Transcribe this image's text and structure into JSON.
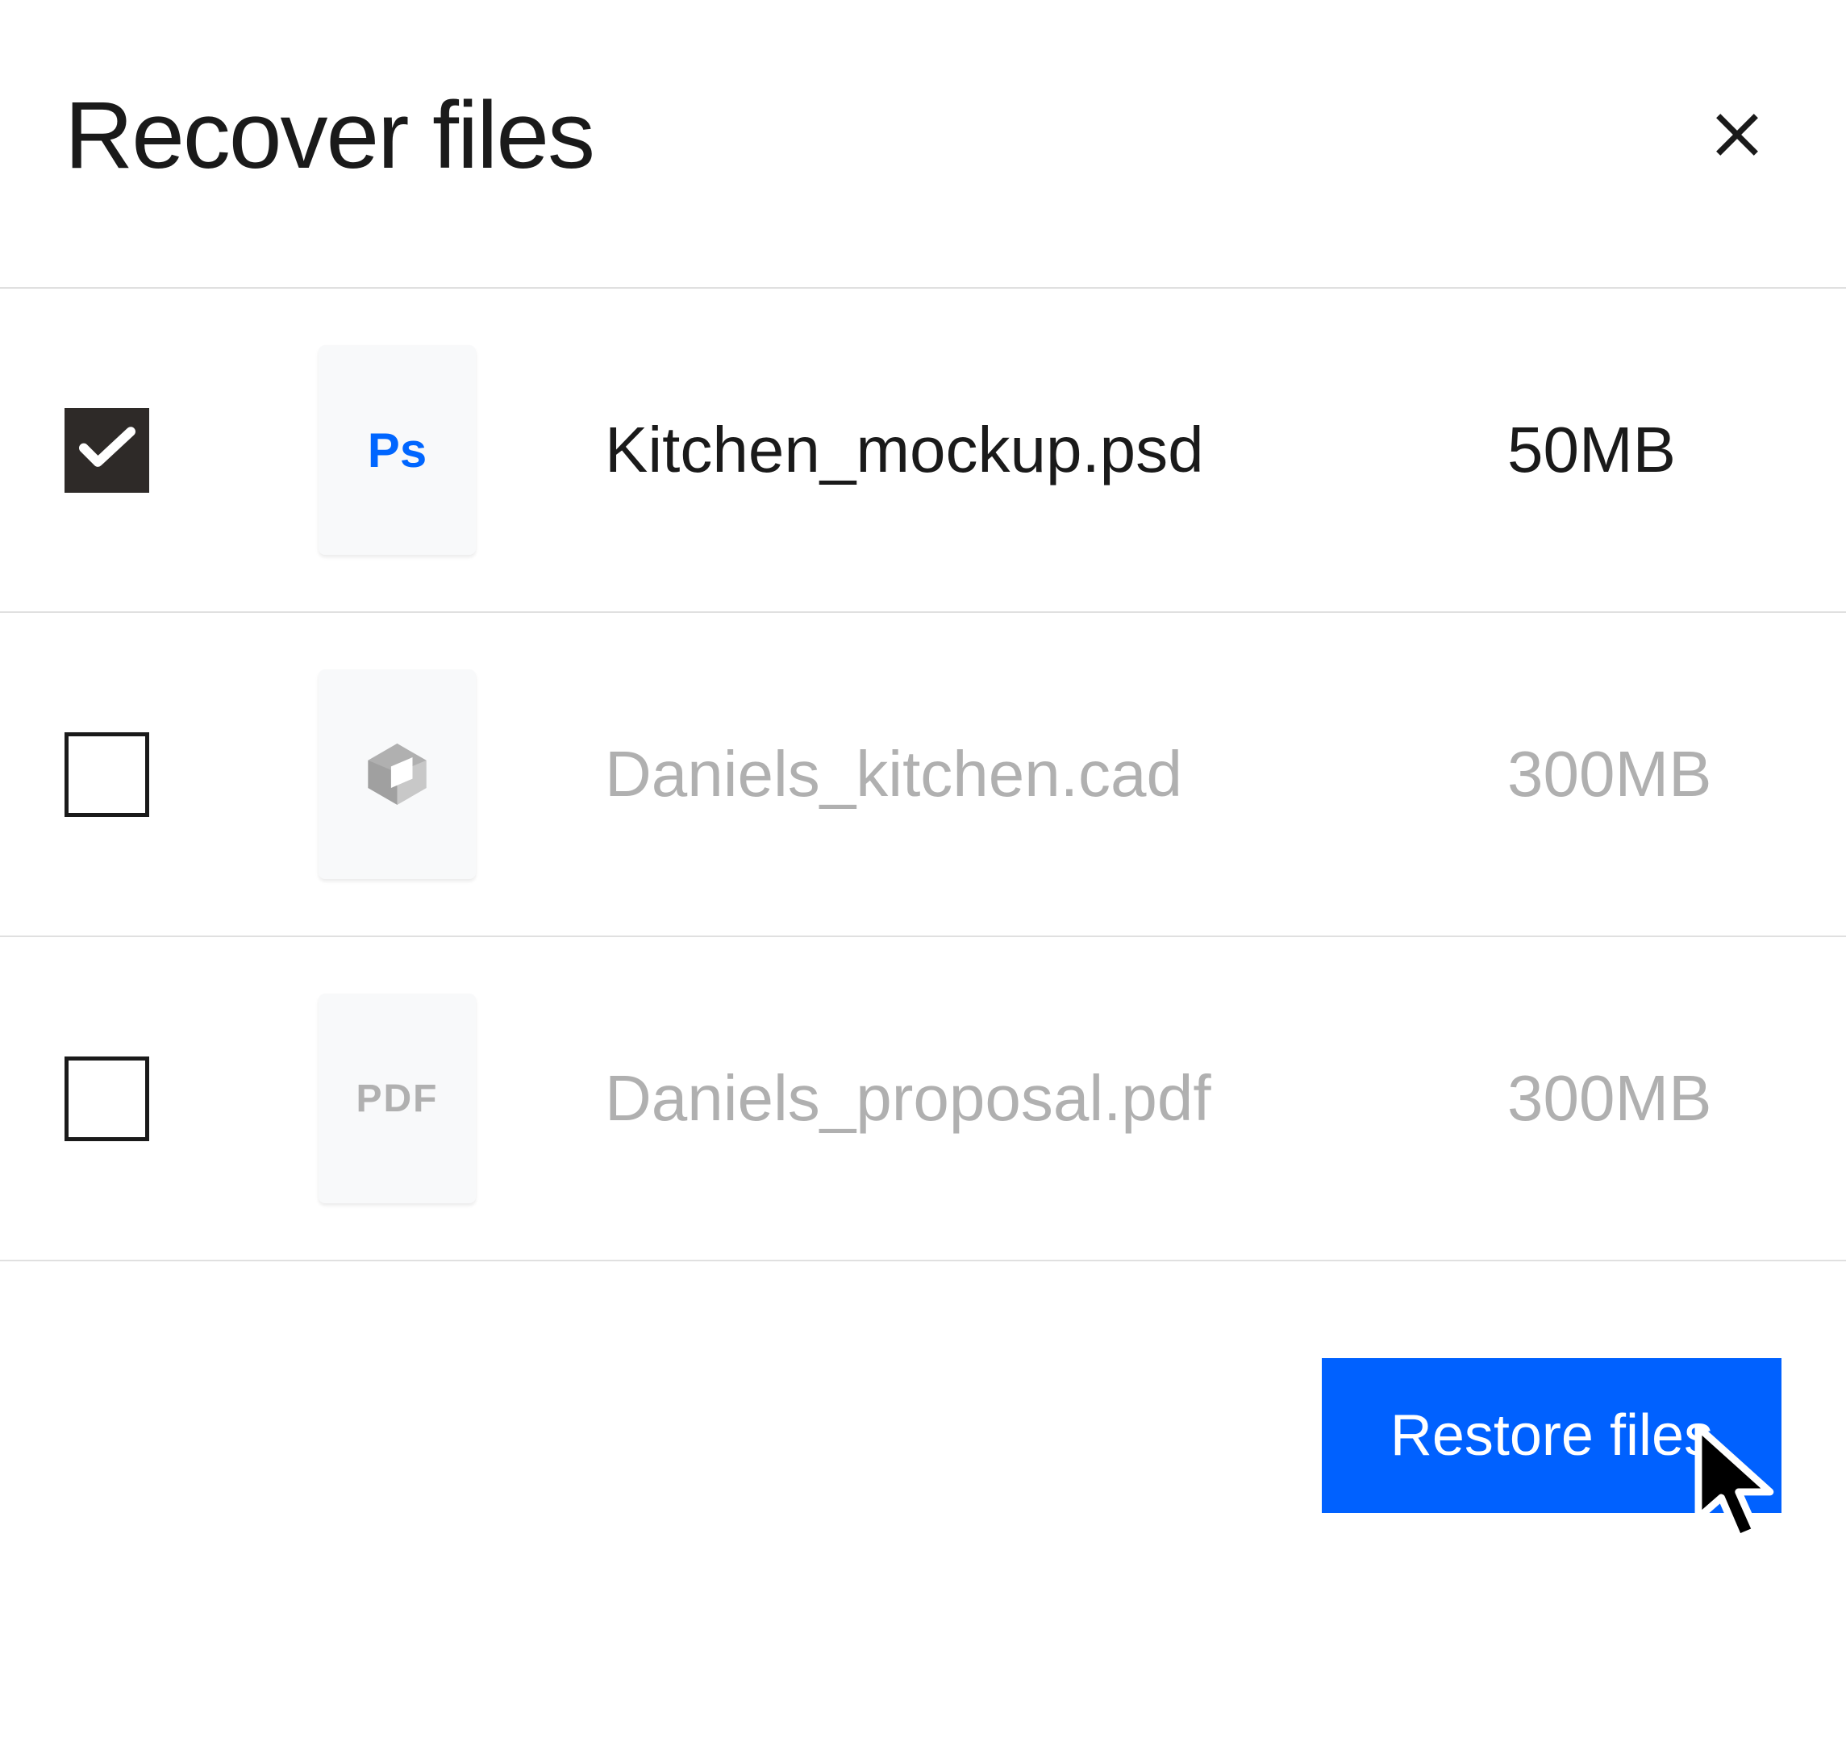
{
  "dialog": {
    "title": "Recover files",
    "close_label": "Close"
  },
  "files": [
    {
      "name": "Kitchen_mockup.psd",
      "size": "50MB",
      "icon": "Ps",
      "icon_type": "ps",
      "checked": true,
      "active": true
    },
    {
      "name": "Daniels_kitchen.cad",
      "size": "300MB",
      "icon": "cad",
      "icon_type": "cad",
      "checked": false,
      "active": false
    },
    {
      "name": "Daniels_proposal.pdf",
      "size": "300MB",
      "icon": "PDF",
      "icon_type": "pdf",
      "checked": false,
      "active": false
    }
  ],
  "actions": {
    "restore_label": "Restore files"
  }
}
